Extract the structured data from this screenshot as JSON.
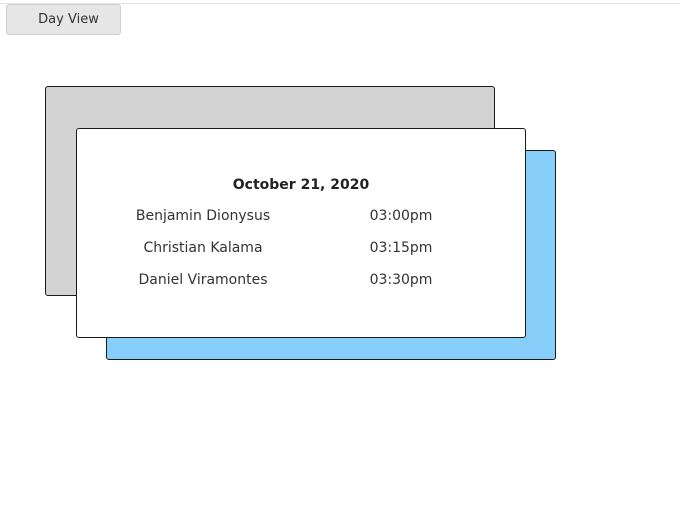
{
  "toolbar": {
    "view_button_label": "Day View"
  },
  "schedule": {
    "date": "October 21, 2020",
    "appointments": [
      {
        "name": "Benjamin Dionysus",
        "time": "03:00pm"
      },
      {
        "name": "Christian Kalama",
        "time": "03:15pm"
      },
      {
        "name": "Daniel Viramontes",
        "time": "03:30pm"
      }
    ]
  },
  "colors": {
    "back_card": "#d3d3d3",
    "accent_card": "#87cefa",
    "front_card": "#ffffff"
  }
}
